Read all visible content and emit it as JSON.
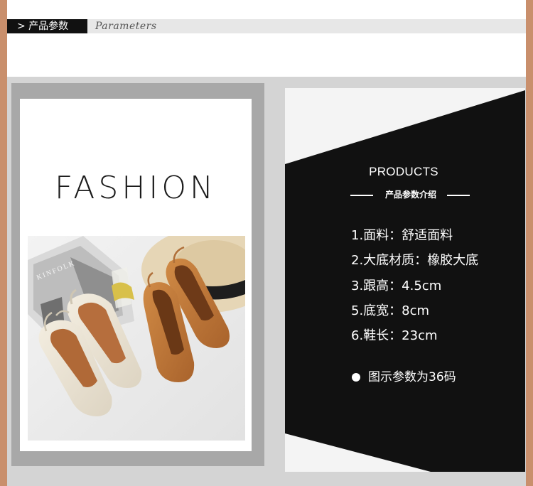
{
  "header": {
    "label_cn": "> 产品参数",
    "label_en": "Parameters"
  },
  "fashion": {
    "title": "FASHION"
  },
  "product_photo": {
    "magazine_text": "KINFOLK"
  },
  "products": {
    "title": "PRODUCTS",
    "subtitle": "产品参数介绍",
    "specs": [
      "1.面料：舒适面料",
      "2.大底材质：橡胶大底",
      "3.跟高：4.5cm",
      "5.底宽：8cm",
      "6.鞋长：23cm"
    ],
    "note": "图示参数为36码"
  },
  "colors": {
    "side_border": "#c98f6c",
    "panel_gray": "#a8a8a8",
    "band_gray": "#d4d4d4",
    "black": "#111111"
  }
}
